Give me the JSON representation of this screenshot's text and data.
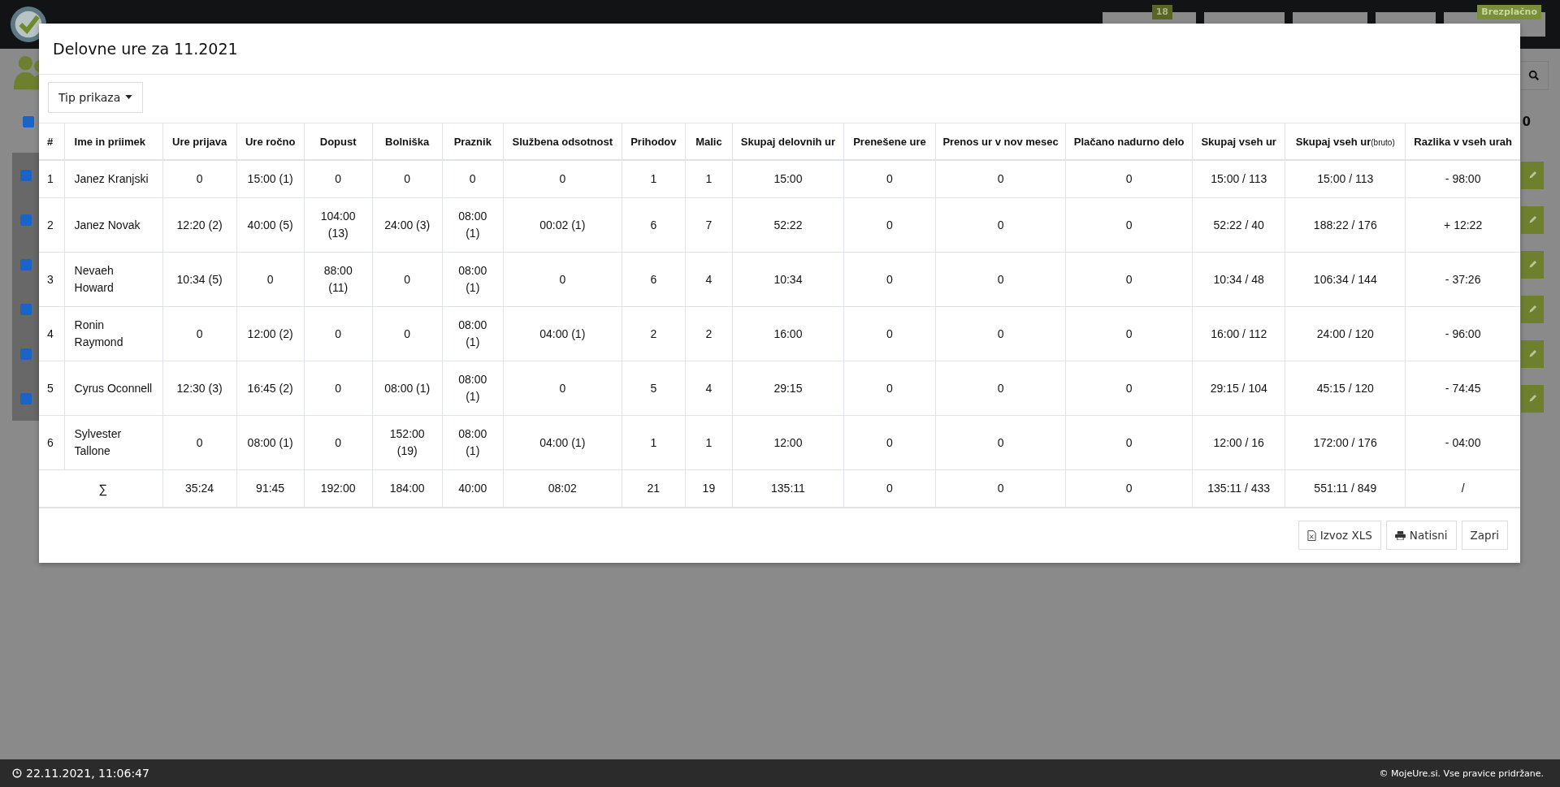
{
  "background": {
    "badges": [
      {
        "text": "18"
      },
      {
        "text": "Brezplačno"
      }
    ],
    "header_text": "0",
    "header_checked": true,
    "rows": [
      {
        "checked": true
      },
      {
        "checked": true
      },
      {
        "checked": true
      },
      {
        "checked": true
      },
      {
        "checked": true
      },
      {
        "checked": true
      }
    ]
  },
  "modal": {
    "title": "Delovne ure za 11.2021",
    "view_button": "Tip prikaza",
    "table": {
      "columns": [
        {
          "label": "#"
        },
        {
          "label": "Ime in priimek"
        },
        {
          "label": "Ure prijava"
        },
        {
          "label": "Ure ročno"
        },
        {
          "label": "Dopust"
        },
        {
          "label": "Bolniška"
        },
        {
          "label": "Praznik"
        },
        {
          "label": "Službena odsotnost"
        },
        {
          "label": "Prihodov"
        },
        {
          "label": "Malic"
        },
        {
          "label": "Skupaj delovnih ur"
        },
        {
          "label": "Prenešene ure"
        },
        {
          "label": "Prenos ur v nov mesec"
        },
        {
          "label": "Plačano nadurno delo"
        },
        {
          "label": "Skupaj vseh ur"
        },
        {
          "label": "Skupaj vseh ur",
          "note": "(bruto)"
        },
        {
          "label": "Razlika v vseh urah"
        }
      ],
      "rows": [
        [
          "1",
          "Janez Kranjski",
          "0",
          "15:00 (1)",
          "0",
          "0",
          "0",
          "0",
          "1",
          "1",
          "15:00",
          "0",
          "0",
          "0",
          "15:00 / 113",
          "15:00 / 113",
          "- 98:00"
        ],
        [
          "2",
          "Janez Novak",
          "12:20 (2)",
          "40:00 (5)",
          "104:00 (13)",
          "24:00 (3)",
          "08:00 (1)",
          "00:02 (1)",
          "6",
          "7",
          "52:22",
          "0",
          "0",
          "0",
          "52:22 / 40",
          "188:22 / 176",
          "+ 12:22"
        ],
        [
          "3",
          "Nevaeh Howard",
          "10:34 (5)",
          "0",
          "88:00 (11)",
          "0",
          "08:00 (1)",
          "0",
          "6",
          "4",
          "10:34",
          "0",
          "0",
          "0",
          "10:34 / 48",
          "106:34 / 144",
          "- 37:26"
        ],
        [
          "4",
          "Ronin Raymond",
          "0",
          "12:00 (2)",
          "0",
          "0",
          "08:00 (1)",
          "04:00 (1)",
          "2",
          "2",
          "16:00",
          "0",
          "0",
          "0",
          "16:00 / 112",
          "24:00 / 120",
          "- 96:00"
        ],
        [
          "5",
          "Cyrus Oconnell",
          "12:30 (3)",
          "16:45 (2)",
          "0",
          "08:00 (1)",
          "08:00 (1)",
          "0",
          "5",
          "4",
          "29:15",
          "0",
          "0",
          "0",
          "29:15 / 104",
          "45:15 / 120",
          "- 74:45"
        ],
        [
          "6",
          "Sylvester Tallone",
          "0",
          "08:00 (1)",
          "0",
          "152:00 (19)",
          "08:00 (1)",
          "04:00 (1)",
          "1",
          "1",
          "12:00",
          "0",
          "0",
          "0",
          "12:00 / 16",
          "172:00 / 176",
          "- 04:00"
        ]
      ],
      "total": [
        "∑",
        "35:24",
        "91:45",
        "192:00",
        "184:00",
        "40:00",
        "08:02",
        "21",
        "19",
        "135:11",
        "0",
        "0",
        "0",
        "135:11 / 433",
        "551:11 / 849",
        "/"
      ]
    },
    "buttons": [
      {
        "label": "Izvoz XLS",
        "kind": "export"
      },
      {
        "label": "Natisni",
        "kind": "print"
      },
      {
        "label": "Zapri",
        "kind": "close"
      }
    ]
  },
  "footer": {
    "time": "22.11.2021, 11:06:47",
    "copyright": "© MojeUre.si. Vse pravice pridržane."
  }
}
